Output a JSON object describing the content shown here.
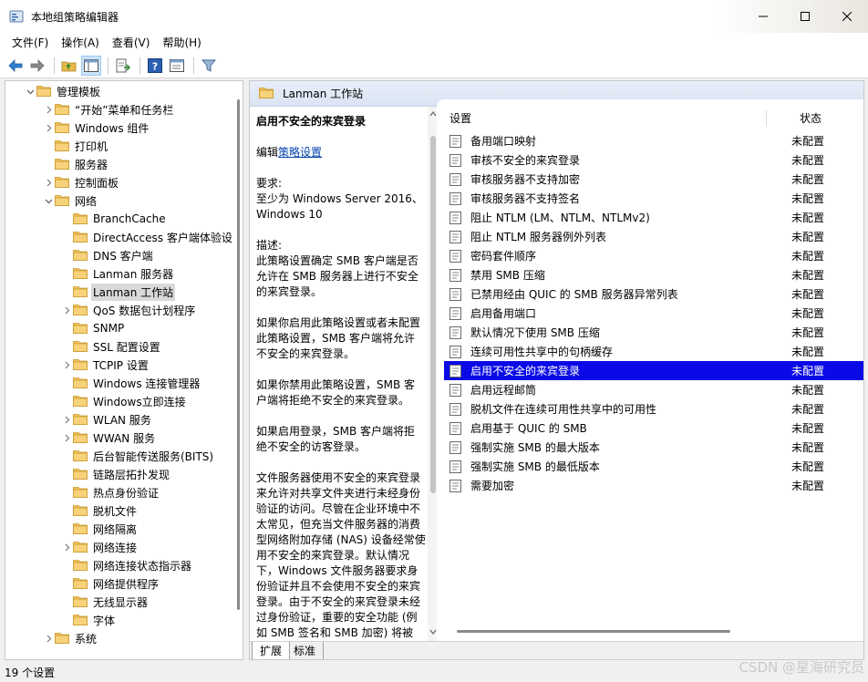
{
  "window": {
    "title": "本地组策略编辑器"
  },
  "menu": [
    "文件(F)",
    "操作(A)",
    "查看(V)",
    "帮助(H)"
  ],
  "tree": [
    {
      "label": "管理模板",
      "level": 1,
      "expander": "open"
    },
    {
      "label": "“开始”菜单和任务栏",
      "level": 2,
      "expander": "closed"
    },
    {
      "label": "Windows 组件",
      "level": 2,
      "expander": "closed"
    },
    {
      "label": "打印机",
      "level": 2,
      "expander": "none"
    },
    {
      "label": "服务器",
      "level": 2,
      "expander": "none"
    },
    {
      "label": "控制面板",
      "level": 2,
      "expander": "closed"
    },
    {
      "label": "网络",
      "level": 2,
      "expander": "open"
    },
    {
      "label": "BranchCache",
      "level": 3,
      "expander": "none"
    },
    {
      "label": "DirectAccess 客户端体验设",
      "level": 3,
      "expander": "none"
    },
    {
      "label": "DNS 客户端",
      "level": 3,
      "expander": "none"
    },
    {
      "label": "Lanman 服务器",
      "level": 3,
      "expander": "none"
    },
    {
      "label": "Lanman 工作站",
      "level": 3,
      "expander": "none",
      "selected": true
    },
    {
      "label": "QoS 数据包计划程序",
      "level": 3,
      "expander": "closed"
    },
    {
      "label": "SNMP",
      "level": 3,
      "expander": "none"
    },
    {
      "label": "SSL 配置设置",
      "level": 3,
      "expander": "none"
    },
    {
      "label": "TCPIP 设置",
      "level": 3,
      "expander": "closed"
    },
    {
      "label": "Windows 连接管理器",
      "level": 3,
      "expander": "none"
    },
    {
      "label": "Windows立即连接",
      "level": 3,
      "expander": "none"
    },
    {
      "label": "WLAN 服务",
      "level": 3,
      "expander": "closed"
    },
    {
      "label": "WWAN 服务",
      "level": 3,
      "expander": "closed"
    },
    {
      "label": "后台智能传送服务(BITS)",
      "level": 3,
      "expander": "none"
    },
    {
      "label": "链路层拓扑发现",
      "level": 3,
      "expander": "none"
    },
    {
      "label": "热点身份验证",
      "level": 3,
      "expander": "none"
    },
    {
      "label": "脱机文件",
      "level": 3,
      "expander": "none"
    },
    {
      "label": "网络隔离",
      "level": 3,
      "expander": "none"
    },
    {
      "label": "网络连接",
      "level": 3,
      "expander": "closed"
    },
    {
      "label": "网络连接状态指示器",
      "level": 3,
      "expander": "none"
    },
    {
      "label": "网络提供程序",
      "level": 3,
      "expander": "none"
    },
    {
      "label": "无线显示器",
      "level": 3,
      "expander": "none"
    },
    {
      "label": "字体",
      "level": 3,
      "expander": "none"
    },
    {
      "label": "系统",
      "level": 2,
      "expander": "closed"
    }
  ],
  "right_header": {
    "title": "Lanman 工作站"
  },
  "description": {
    "title": "启用不安全的来宾登录",
    "edit_prefix": "编辑",
    "edit_link": "策略设置",
    "req_label": "要求:",
    "req_value": "至少为 Windows Server 2016、Windows 10",
    "desc_label": "描述:",
    "desc_p1": "此策略设置确定 SMB 客户端是否允许在 SMB 服务器上进行不安全的来宾登录。",
    "desc_p2": "如果你启用此策略设置或者未配置此策略设置，SMB 客户端将允许不安全的来宾登录。",
    "desc_p3": "如果你禁用此策略设置，SMB 客户端将拒绝不安全的来宾登录。",
    "desc_p4": "如果启用登录，SMB 客户端将拒绝不安全的访客登录。",
    "desc_p5": "文件服务器使用不安全的来宾登录来允许对共享文件夹进行未经身份验证的访问。尽管在企业环境中不太常见，但充当文件服务器的消费型网络附加存储 (NAS) 设备经常使用不安全的来宾登录。默认情况下，Windows 文件服务器要求身份验证并且不会使用不安全的来宾登录。由于不安全的来宾登录未经过身份验证，重要的安全功能 (例如 SMB 签名和 SMB 加密) 将被"
  },
  "list": {
    "col_setting": "设置",
    "col_state": "状态",
    "rows": [
      {
        "name": "备用端口映射",
        "state": "未配置"
      },
      {
        "name": "审核不安全的来宾登录",
        "state": "未配置"
      },
      {
        "name": "审核服务器不支持加密",
        "state": "未配置"
      },
      {
        "name": "审核服务器不支持签名",
        "state": "未配置"
      },
      {
        "name": "阻止 NTLM (LM、NTLM、NTLMv2)",
        "state": "未配置"
      },
      {
        "name": "阻止 NTLM 服务器例外列表",
        "state": "未配置"
      },
      {
        "name": "密码套件顺序",
        "state": "未配置"
      },
      {
        "name": "禁用 SMB 压缩",
        "state": "未配置"
      },
      {
        "name": "已禁用经由 QUIC 的 SMB 服务器异常列表",
        "state": "未配置"
      },
      {
        "name": "启用备用端口",
        "state": "未配置"
      },
      {
        "name": "默认情况下使用 SMB 压缩",
        "state": "未配置"
      },
      {
        "name": "连续可用性共享中的句柄缓存",
        "state": "未配置"
      },
      {
        "name": "启用不安全的来宾登录",
        "state": "未配置",
        "selected": true
      },
      {
        "name": "启用远程邮筒",
        "state": "未配置"
      },
      {
        "name": "脱机文件在连续可用性共享中的可用性",
        "state": "未配置"
      },
      {
        "name": "启用基于 QUIC 的 SMB",
        "state": "未配置"
      },
      {
        "name": "强制实施 SMB 的最大版本",
        "state": "未配置"
      },
      {
        "name": "强制实施 SMB 的最低版本",
        "state": "未配置"
      },
      {
        "name": "需要加密",
        "state": "未配置"
      }
    ]
  },
  "tabs": {
    "extended": "扩展",
    "standard": "标准"
  },
  "status": {
    "text": "19 个设置"
  },
  "watermark": "CSDN @星海研究员",
  "colors": {
    "selection": "#0a0ae6",
    "folder": "#f2c35a",
    "link": "#0645ad"
  }
}
